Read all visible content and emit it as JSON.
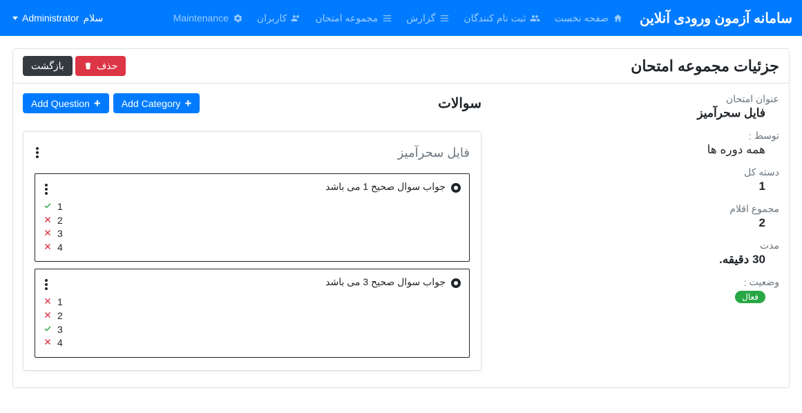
{
  "nav": {
    "brand": "سامانه آزمون ورودی آنلاین",
    "links": [
      {
        "label": "صفحه نخست"
      },
      {
        "label": "ثبت نام کنندگان"
      },
      {
        "label": "گزارش"
      },
      {
        "label": "مجموعه امتحان"
      },
      {
        "label": "کاربران"
      },
      {
        "label": "Maintenance"
      }
    ],
    "user_prefix": "سلام",
    "user_name": "Administrator"
  },
  "page": {
    "title": "جزئیات مجموعه امتحان",
    "delete_btn": "حذف",
    "back_btn": "بازگشت"
  },
  "info": {
    "title_label": "عنوان امتحان",
    "title_value": "فایل سحرآمیز",
    "by_label": "توسط",
    "by_value": "همه دوره ها",
    "total_cat_label": "دسته کل",
    "total_cat_value": "1",
    "total_items_label": "مجموع اقلام",
    "total_items_value": "2",
    "duration_label": "مدت",
    "duration_value": "30 دقیقه.",
    "status_label": "وضعیت",
    "status_value": "فعال"
  },
  "questions": {
    "heading": "سوالات",
    "add_category": "Add Category",
    "add_question": "Add Question",
    "category_title": "فایل سحرآمیز",
    "items": [
      {
        "text": "جواب سوال صحیح 1 می باشد",
        "opts": [
          {
            "n": "1",
            "ok": true
          },
          {
            "n": "2",
            "ok": false
          },
          {
            "n": "3",
            "ok": false
          },
          {
            "n": "4",
            "ok": false
          }
        ]
      },
      {
        "text": "جواب سوال صحیح 3 می باشد",
        "opts": [
          {
            "n": "1",
            "ok": false
          },
          {
            "n": "2",
            "ok": false
          },
          {
            "n": "3",
            "ok": true
          },
          {
            "n": "4",
            "ok": false
          }
        ]
      }
    ]
  }
}
